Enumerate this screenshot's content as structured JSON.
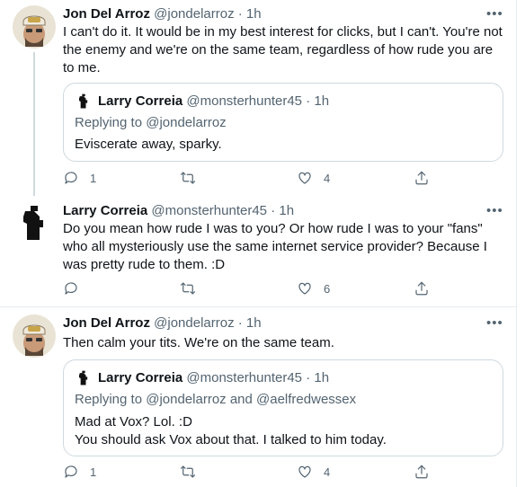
{
  "tweets": [
    {
      "name": "Jon Del Arroz",
      "handle": "@jondelarroz",
      "time": "· 1h",
      "more": "•••",
      "text": "I can't do it. It would be in my best interest for clicks, but I can't. You're not the enemy and we're on the same team, regardless of how rude you are to me.",
      "quote": {
        "name": "Larry Correia",
        "handle": "@monsterhunter45",
        "time": "· 1h",
        "reply_prefix": "Replying to",
        "mentions": "@jondelarroz",
        "text": "Eviscerate away, sparky."
      },
      "actions": {
        "reply": "1",
        "retweet": "",
        "like": "4"
      }
    },
    {
      "name": "Larry Correia",
      "handle": "@monsterhunter45",
      "time": "· 1h",
      "more": "•••",
      "text": "Do you mean how rude I was to you? Or how rude I was to your \"fans\" who all mysteriously use the same internet service provider? Because I was pretty rude to them. :D",
      "actions": {
        "reply": "",
        "retweet": "",
        "like": "6"
      }
    },
    {
      "name": "Jon Del Arroz",
      "handle": "@jondelarroz",
      "time": "· 1h",
      "more": "•••",
      "text": "Then calm your tits. We're on the same team.",
      "quote": {
        "name": "Larry Correia",
        "handle": "@monsterhunter45",
        "time": "· 1h",
        "reply_prefix": "Replying to",
        "mentions": "@jondelarroz and @aelfredwessex",
        "text_line1": "Mad at Vox? Lol. :D",
        "text_line2": "You should ask Vox about that. I talked to him today."
      },
      "actions": {
        "reply": "1",
        "retweet": "",
        "like": "4"
      }
    }
  ],
  "icons": {
    "reply": "reply-icon",
    "retweet": "retweet-icon",
    "like": "heart-icon",
    "share": "share-icon",
    "more": "more-icon"
  }
}
